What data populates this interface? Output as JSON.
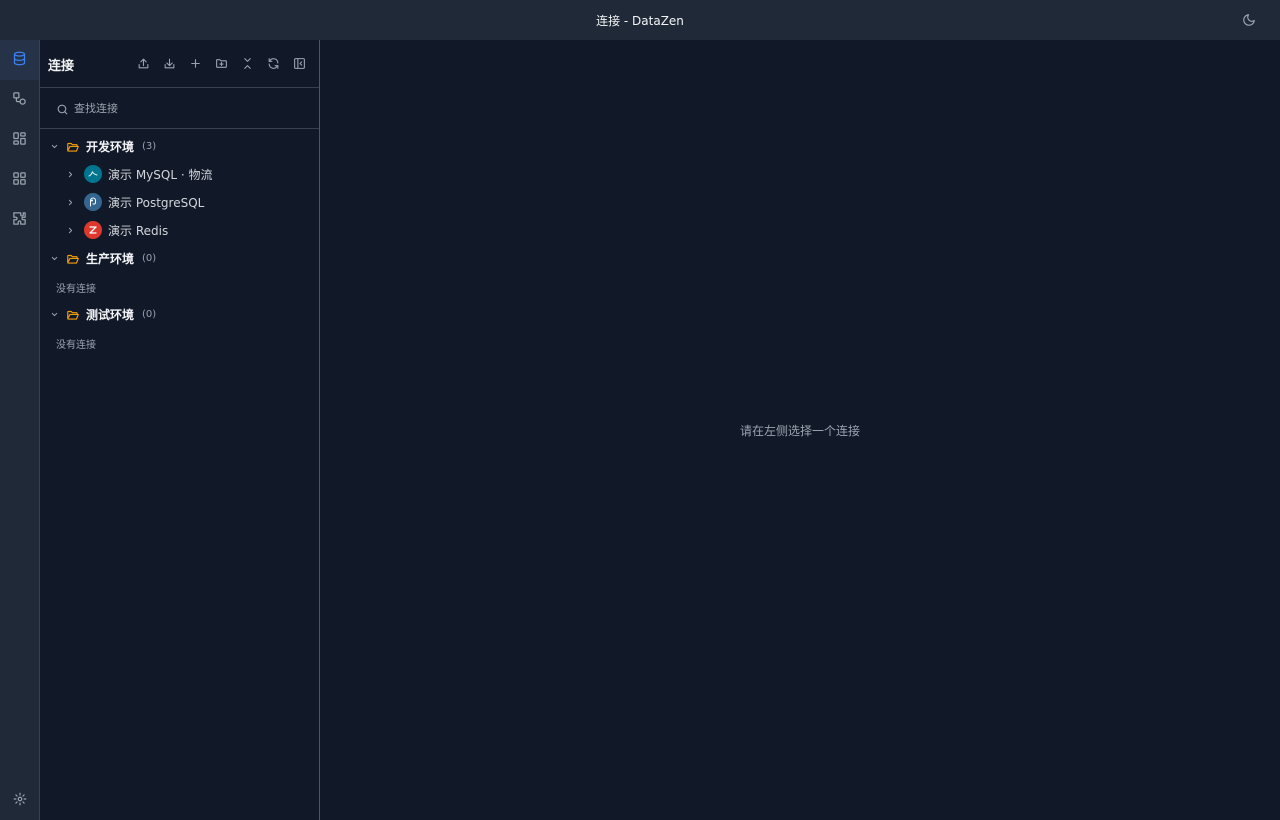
{
  "window": {
    "title": "连接 - DataZen"
  },
  "activity_bar": {
    "items": [
      {
        "name": "database-icon",
        "active": true
      },
      {
        "name": "schema-icon",
        "active": false
      },
      {
        "name": "dashboard-icon",
        "active": false
      },
      {
        "name": "apps-grid-icon",
        "active": false
      },
      {
        "name": "plugin-icon",
        "active": false
      }
    ],
    "bottom": {
      "name": "gear-icon"
    }
  },
  "sidebar": {
    "title": "连接",
    "toolbar": [
      "export-icon",
      "import-icon",
      "plus-icon",
      "folder-add-icon",
      "collapse-all-icon",
      "refresh-icon",
      "panel-toggle-icon"
    ],
    "search": {
      "placeholder": "查找连接",
      "value": ""
    },
    "groups": [
      {
        "label": "开发环境",
        "count": "(3)",
        "expanded": true,
        "connections": [
          {
            "label": "演示 MySQL · 物流",
            "icon": "mysql-icon",
            "color": "#00758f"
          },
          {
            "label": "演示 PostgreSQL",
            "icon": "postgresql-icon",
            "color": "#336791"
          },
          {
            "label": "演示 Redis",
            "icon": "redis-icon",
            "color": "#dc382d"
          }
        ]
      },
      {
        "label": "生产环境",
        "count": "(0)",
        "expanded": true,
        "empty_text": "没有连接",
        "connections": []
      },
      {
        "label": "测试环境",
        "count": "(0)",
        "expanded": true,
        "empty_text": "没有连接",
        "connections": []
      }
    ]
  },
  "main": {
    "hint": "请在左侧选择一个连接"
  },
  "colors": {
    "accent": "#3b82f6",
    "folder": "#f59e0b",
    "titlebar_bg": "#1f2937",
    "content_bg": "#111827"
  }
}
